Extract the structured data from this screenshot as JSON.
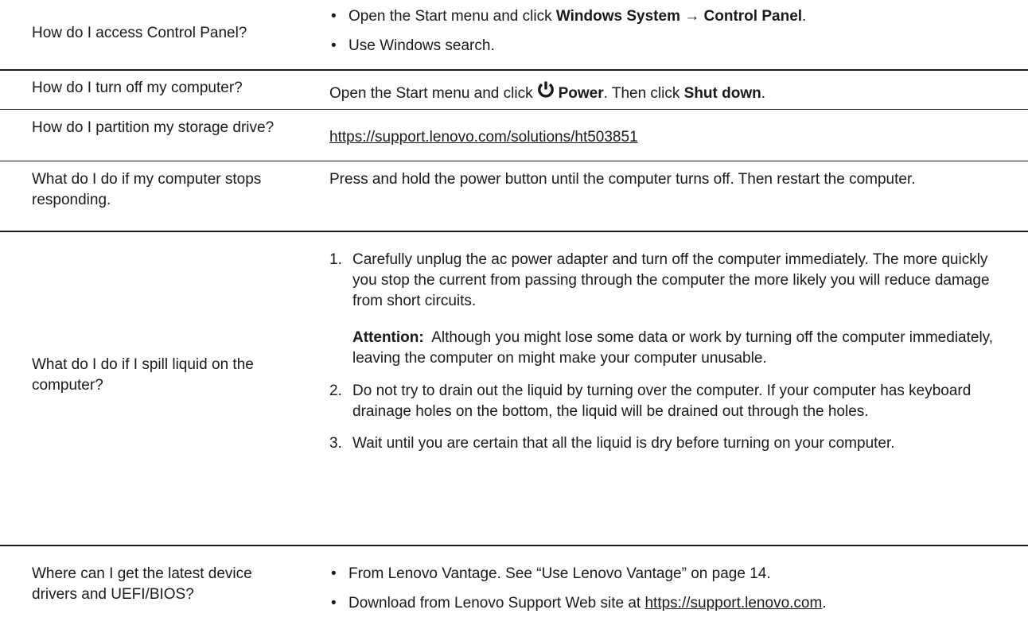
{
  "rows": [
    {
      "question": "How do I access Control Panel?",
      "bullets": [
        {
          "prefix": "Open the Start menu and click ",
          "bold1": "Windows System",
          "arrow": "→",
          "bold2": "Control Panel",
          "suffix": "."
        },
        {
          "text": "Use Windows search."
        }
      ]
    },
    {
      "question": "How do I turn off my computer?",
      "answer_prefix": "Open the Start menu and click",
      "power_icon": "power-icon",
      "bold1": "Power",
      "middle": ". Then click ",
      "bold2": "Shut down",
      "suffix": "."
    },
    {
      "question": "How do I partition my storage drive?",
      "link": "https://support.lenovo.com/solutions/ht503851"
    },
    {
      "question": "What do I do if my computer stops responding.",
      "answer": "Press and hold the power button until the computer turns off. Then restart the computer."
    },
    {
      "question": "What do I do if I spill liquid on the computer?",
      "steps": [
        {
          "num": "1.",
          "text": "Carefully unplug the ac power adapter and turn off the computer immediately. The more quickly you stop the current from passing through the computer the more likely you will reduce damage from short circuits.",
          "attention_label": "Attention:",
          "attention_text": "Although you might lose some data or work by turning off the computer immediately, leaving the computer on might make your computer unusable."
        },
        {
          "num": "2.",
          "text": "Do not try to drain out the liquid by turning over the computer. If your computer has keyboard drainage holes on the bottom, the liquid will be drained out through the holes."
        },
        {
          "num": "3.",
          "text": "Wait until you are certain that all the liquid is dry before turning on your computer."
        }
      ]
    },
    {
      "question": "Where can I get the latest device drivers and UEFI/BIOS?",
      "bullets": [
        {
          "text": "From Lenovo Vantage. See “Use Lenovo Vantage” on page 14."
        },
        {
          "prefix": "Download from Lenovo Support Web site at ",
          "link": "https://support.lenovo.com",
          "suffix": "."
        }
      ]
    }
  ],
  "bullet_char": "•"
}
